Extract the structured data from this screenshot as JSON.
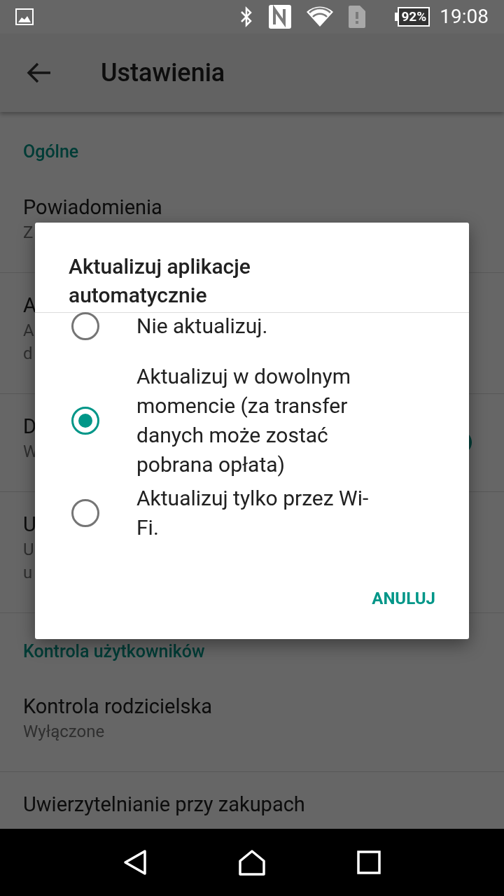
{
  "status_bar": {
    "battery": "92%",
    "time": "19:08"
  },
  "app_bar": {
    "title": "Ustawienia"
  },
  "sections": [
    {
      "header": "Ogólne",
      "items": [
        {
          "title": "Powiadomienia",
          "subtitle_lines": [
            "Z"
          ]
        },
        {
          "title": "A",
          "subtitle_lines": [
            "A",
            "d"
          ]
        },
        {
          "title": "D",
          "subtitle_lines": [
            "W"
          ],
          "kind": "switch",
          "on": true
        },
        {
          "title": "U",
          "subtitle_lines": [
            "U",
            "u"
          ]
        }
      ]
    },
    {
      "header": "Kontrola użytkowników",
      "items": [
        {
          "title": "Kontrola rodzicielska",
          "subtitle_lines": [
            "Wyłączone"
          ]
        },
        {
          "title": "Uwierzytelnianie przy zakupach"
        }
      ]
    }
  ],
  "dialog": {
    "title": "Aktualizuj aplikacje automatycznie",
    "options": [
      {
        "label": "Nie aktualizuj.",
        "selected": false
      },
      {
        "label": "Aktualizuj w dowolnym momencie (za transfer danych może zostać pobrana opłata)",
        "selected": true
      },
      {
        "label": "Aktualizuj tylko przez Wi-Fi.",
        "selected": false
      }
    ],
    "buttons": [
      "ANULUJ"
    ]
  }
}
